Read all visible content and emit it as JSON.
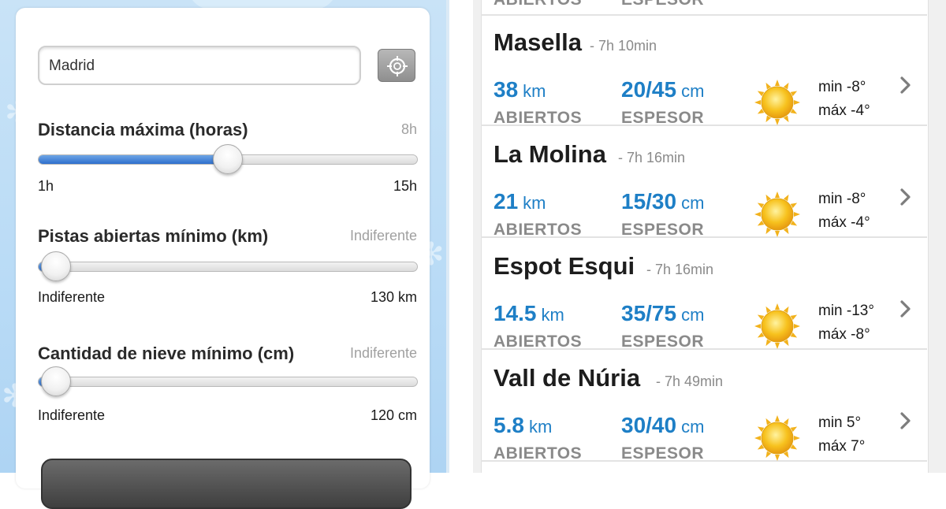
{
  "filters": {
    "location_value": "Madrid",
    "gps_icon": "crosshair-icon",
    "distance": {
      "label": "Distancia máxima (horas)",
      "current": "8h",
      "min": "1h",
      "max": "15h",
      "fraction": 0.5
    },
    "pistas": {
      "label": "Pistas abiertas mínimo (km)",
      "current": "Indiferente",
      "min": "Indiferente",
      "max": "130 km",
      "fraction": 0.0
    },
    "nieve": {
      "label": "Cantidad de nieve mínimo (cm)",
      "current": "Indiferente",
      "min": "Indiferente",
      "max": "120 cm",
      "fraction": 0.0
    }
  },
  "results": {
    "top_stub": {
      "col1": "ABIERTOS",
      "col2": "ESPESOR"
    },
    "rows": [
      {
        "name": "Masella",
        "time": "- 7h 10min",
        "km": "38",
        "km_unit": "km",
        "km_caption": "ABIERTOS",
        "depth": "20/45",
        "depth_unit": "cm",
        "depth_caption": "ESPESOR",
        "weather_icon": "sun-icon",
        "tmin": "min  -8°",
        "tmax": "máx -4°"
      },
      {
        "name": "La Molina",
        "time": "- 7h 16min",
        "km": "21",
        "km_unit": "km",
        "km_caption": "ABIERTOS",
        "depth": "15/30",
        "depth_unit": "cm",
        "depth_caption": "ESPESOR",
        "weather_icon": "sun-icon",
        "tmin": "min  -8°",
        "tmax": "máx -4°"
      },
      {
        "name": "Espot Esqui",
        "time": "- 7h 16min",
        "km": "14.5",
        "km_unit": "km",
        "km_caption": "ABIERTOS",
        "depth": "35/75",
        "depth_unit": "cm",
        "depth_caption": "ESPESOR",
        "weather_icon": "sun-icon",
        "tmin": "min  -13°",
        "tmax": "máx -8°"
      },
      {
        "name": "Vall de Núria",
        "time": "- 7h 49min",
        "km": "5.8",
        "km_unit": "km",
        "km_caption": "ABIERTOS",
        "depth": "30/40",
        "depth_unit": "cm",
        "depth_caption": "ESPESOR",
        "weather_icon": "sun-icon",
        "tmin": "min  5°",
        "tmax": "máx 7°"
      }
    ]
  }
}
